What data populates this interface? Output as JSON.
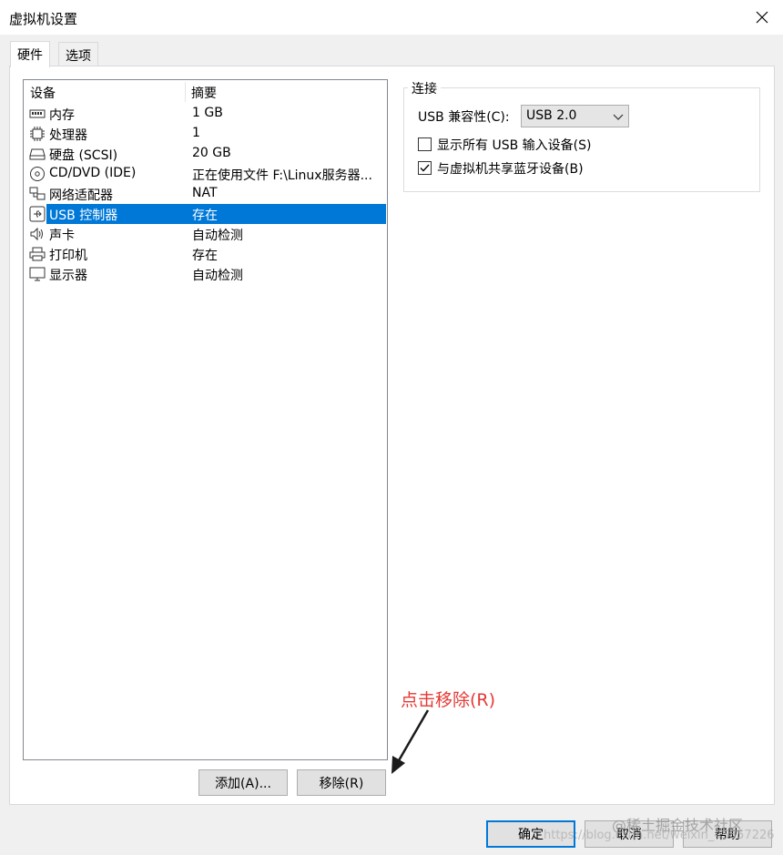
{
  "window": {
    "title": "虚拟机设置"
  },
  "tabs": [
    {
      "label": "硬件",
      "active": true
    },
    {
      "label": "选项",
      "active": false
    }
  ],
  "device_list": {
    "columns": [
      "设备",
      "摘要"
    ],
    "rows": [
      {
        "icon": "memory-icon",
        "name": "内存",
        "summary": "1 GB",
        "selected": false
      },
      {
        "icon": "processor-icon",
        "name": "处理器",
        "summary": "1",
        "selected": false
      },
      {
        "icon": "hard-disk-icon",
        "name": "硬盘 (SCSI)",
        "summary": "20 GB",
        "selected": false
      },
      {
        "icon": "cd-dvd-icon",
        "name": "CD/DVD (IDE)",
        "summary": "正在使用文件 F:\\Linux服务器...",
        "selected": false
      },
      {
        "icon": "network-adapter-icon",
        "name": "网络适配器",
        "summary": "NAT",
        "selected": false
      },
      {
        "icon": "usb-icon",
        "name": "USB 控制器",
        "summary": "存在",
        "selected": true
      },
      {
        "icon": "speaker-icon",
        "name": "声卡",
        "summary": "自动检测",
        "selected": false
      },
      {
        "icon": "printer-icon",
        "name": "打印机",
        "summary": "存在",
        "selected": false
      },
      {
        "icon": "monitor-icon",
        "name": "显示器",
        "summary": "自动检测",
        "selected": false
      }
    ]
  },
  "list_buttons": {
    "add": "添加(A)...",
    "remove": "移除(R)"
  },
  "connection": {
    "group_title": "连接",
    "compat_label": "USB 兼容性(C):",
    "compat_value": "USB 2.0",
    "show_all_usb": {
      "label": "显示所有 USB 输入设备(S)",
      "checked": false
    },
    "share_bluetooth": {
      "label": "与虚拟机共享蓝牙设备(B)",
      "checked": true
    }
  },
  "annotation": "点击移除(R)",
  "dialog_buttons": {
    "ok": "确定",
    "cancel": "取消",
    "help": "帮助"
  },
  "watermarks": [
    "@稀土掘金技术社区",
    "https://blog.csdn.net/weixin_45857226"
  ],
  "colors": {
    "selection": "#0078d7",
    "annotation": "#e53935"
  }
}
